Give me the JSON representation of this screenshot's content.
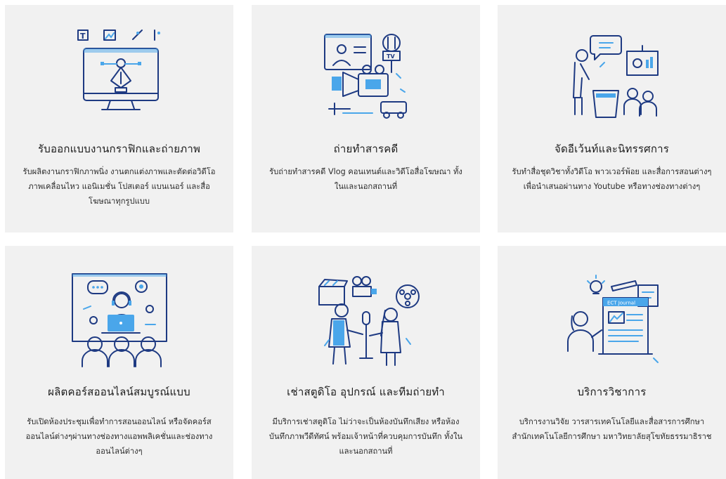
{
  "services": [
    {
      "title": "รับออกแบบงานกราฟิกและถ่ายภาพ",
      "description": "รับผลิตงานกราฟิกภาพนิ่ง งานตกแต่งภาพและตัดต่อวิดีโอ ภาพเคลื่อนไหว แอนิเมชั่น โปสเตอร์ แบนเนอร์ และสื่อโฆษณาทุกรูปแบบ",
      "icon": "graphic-design-illustration"
    },
    {
      "title": "ถ่ายทำสารคดี",
      "description": "รับถ่ายทำสารคดี Vlog คอนเทนต์และวิดีโอสื่อโฆษณา ทั้งในและนอกสถานที่",
      "icon": "video-production-illustration"
    },
    {
      "title": "จัดอีเว้นท์และนิทรรศการ",
      "description": "รับทำสื่อชุดวิชาทั้งวิดีโอ พาวเวอร์พ้อย และสื่อการสอนต่างๆเพื่อนำเสนอผ่านทาง Youtube หรือทางช่องทางต่างๆ",
      "icon": "event-presentation-illustration"
    },
    {
      "title": "ผลิตคอร์สออนไลน์สมบูรณ์แบบ",
      "description": "รับเปิดห้องประชุมเพื่อทำการสอนออนไลน์ หรือจัดคอร์สออนไลน์ต่างๆผ่านทางช่องทางแอพพลิเคชั่นและช่องทางออนไลน์ต่างๆ",
      "icon": "online-course-illustration"
    },
    {
      "title": "เช่าสตูดิโอ อุปกรณ์ และทีมถ่ายทำ",
      "description": "มีบริการเช่าสตูดิโอ ไม่ว่าจะเป็นห้องบันทึกเสียง หรือห้องบันทึกภาพวีดีทัศน์ พร้อมเจ้าหน้าที่ควบคุมการบันทึก ทั้งในและนอกสถานที่",
      "icon": "studio-rental-illustration"
    },
    {
      "title": "บริการวิชาการ",
      "description": "บริการงานวิจัย วารสารเทคโนโลยีและสื่อสารการศึกษา สำนักเทคโนโลยีการศึกษา มหาวิทยาลัยสุโขทัยธรรมาธิราช",
      "icon": "academic-service-illustration",
      "illustration_text": "ECT Journal"
    }
  ],
  "colors": {
    "card_bg": "#f1f1f1",
    "line": "#1e3a82",
    "accent": "#4aa6ea"
  }
}
